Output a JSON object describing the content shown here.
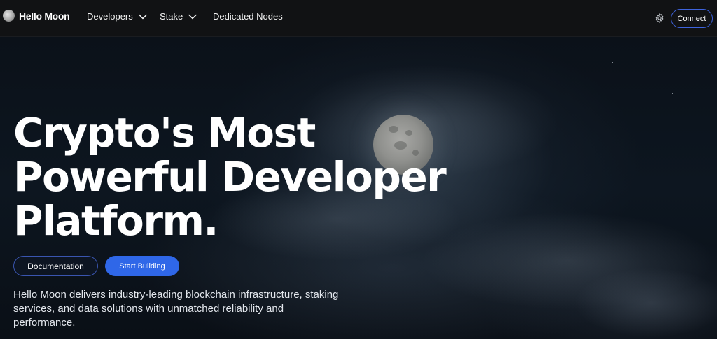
{
  "brand": {
    "name": "Hello Moon",
    "logo_icon": "moon-logo-icon"
  },
  "nav": {
    "items": [
      {
        "label": "Developers",
        "has_dropdown": true
      },
      {
        "label": "Stake",
        "has_dropdown": true
      },
      {
        "label": "Dedicated Nodes",
        "has_dropdown": false
      }
    ],
    "settings_icon": "gear-icon",
    "connect_label": "Connect"
  },
  "hero": {
    "headline_lines": [
      "Crypto's Most",
      "Powerful Developer",
      "Platform."
    ],
    "buttons": {
      "documentation": "Documentation",
      "start_building": "Start Building"
    },
    "description": "Hello Moon delivers industry-leading blockchain infrastructure, staking services, and data solutions with unmatched reliability and performance."
  },
  "colors": {
    "accent": "#2f67e8",
    "nav_background": "#111214",
    "connect_border": "#3e63dd"
  }
}
